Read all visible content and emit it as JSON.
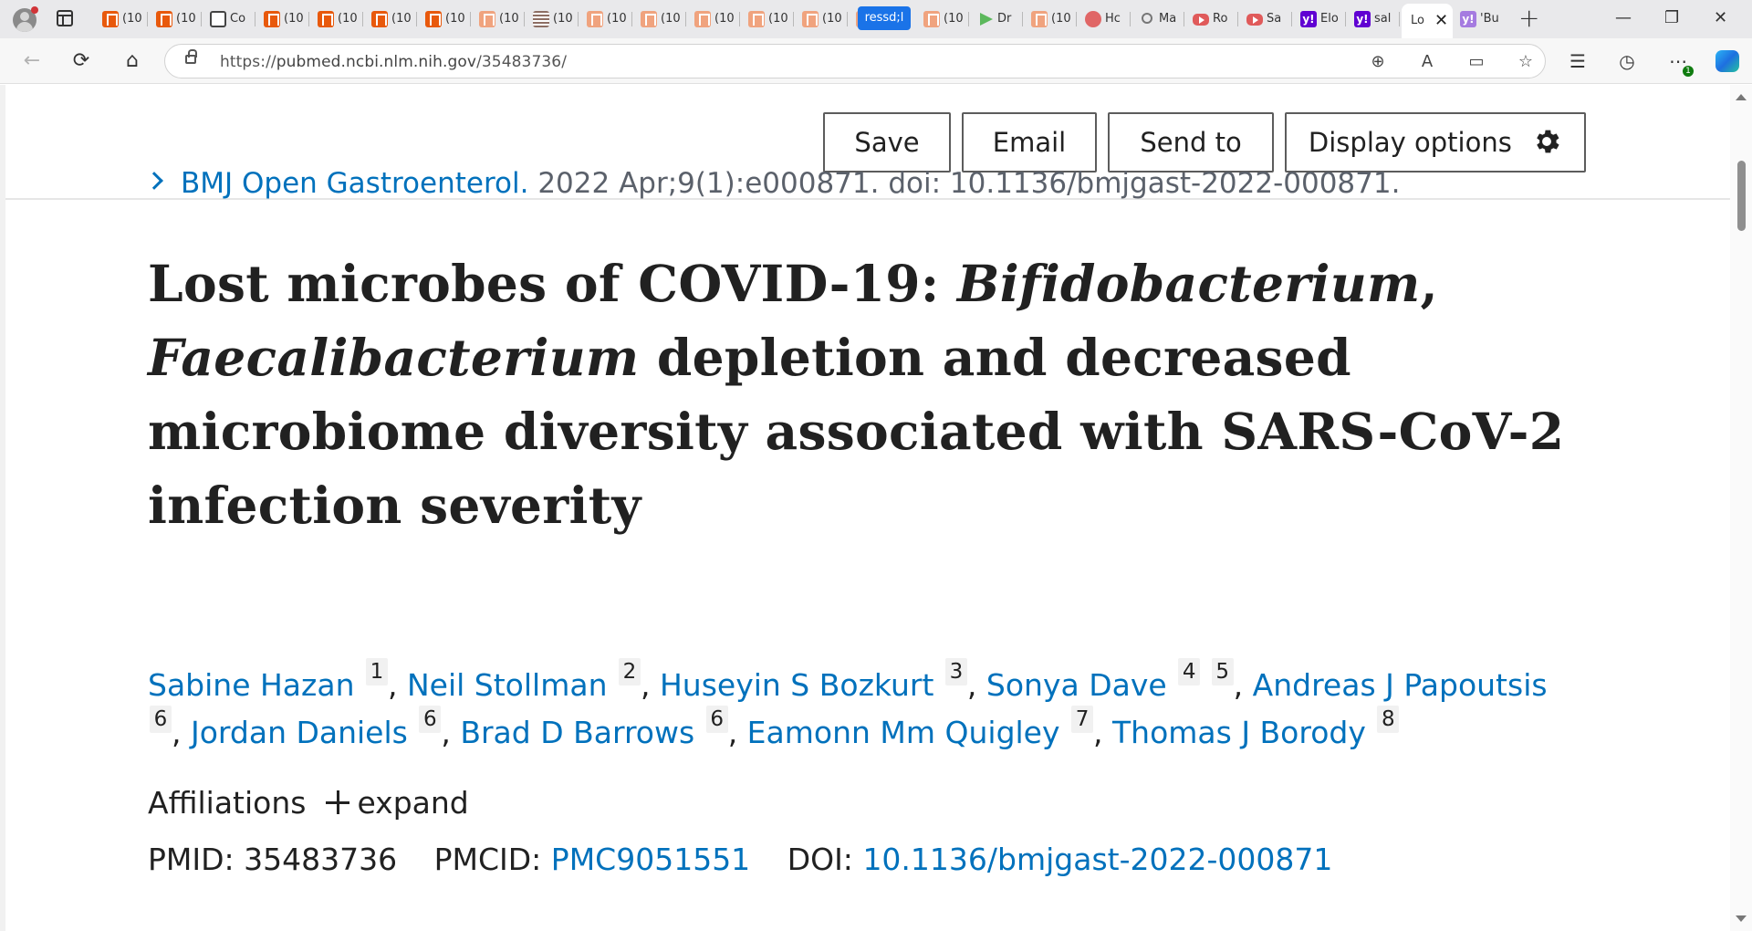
{
  "browser": {
    "tabs": [
      {
        "icon": "bookmark-icon",
        "label": "(10"
      },
      {
        "icon": "bookmark-icon",
        "label": "(10"
      },
      {
        "icon": "lock-icon",
        "label": "Co"
      },
      {
        "icon": "bookmark-icon",
        "label": "(10"
      },
      {
        "icon": "bookmark-icon",
        "label": "(10"
      },
      {
        "icon": "bookmark-icon",
        "label": "(10"
      },
      {
        "icon": "bookmark-icon",
        "label": "(10"
      },
      {
        "icon": "bookmark-light-icon",
        "label": "(10"
      },
      {
        "icon": "grid-icon",
        "label": "(10"
      },
      {
        "icon": "bookmark-light-icon",
        "label": "(10"
      },
      {
        "icon": "bookmark-light-icon",
        "label": "(10"
      },
      {
        "icon": "bookmark-light-icon",
        "label": "(10"
      },
      {
        "icon": "bookmark-light-icon",
        "label": "(10"
      },
      {
        "icon": "bookmark-light-icon",
        "label": "(10"
      },
      {
        "icon": "bookmark-light-icon",
        "label": "(10"
      }
    ],
    "highlight_tab": "ressd;l",
    "tabs_right": [
      {
        "icon": "bookmark-light-icon",
        "label": "(10"
      },
      {
        "icon": "play-icon",
        "label": "Dr"
      },
      {
        "icon": "bookmark-light-icon",
        "label": "(10"
      },
      {
        "icon": "pin-icon",
        "label": "Hc"
      },
      {
        "icon": "search-icon",
        "label": "Ma"
      },
      {
        "icon": "youtube-icon",
        "label": "Ro"
      },
      {
        "icon": "youtube-icon",
        "label": "Sa"
      },
      {
        "icon": "yahoo-icon",
        "label": "Elo"
      },
      {
        "icon": "yahoo-icon",
        "label": "sal"
      }
    ],
    "active_tab": {
      "label": "Lo",
      "close": "✕"
    },
    "last_tab": {
      "icon": "yahoo-light-icon",
      "label": "'Bu"
    },
    "new_tab": "+",
    "window": {
      "minimize": "—",
      "restore": "❐",
      "close": "✕"
    },
    "url": {
      "prefix": "https://",
      "host": "pubmed.ncbi.nlm.nih.gov",
      "path": "/35483736/"
    },
    "accent_colors": {
      "tab_strip": "#e9e9eb",
      "highlight_tab": "#1a73e8"
    }
  },
  "toolbar": {
    "save": "Save",
    "email": "Email",
    "send_to": "Send to",
    "display_options": "Display options"
  },
  "citation": {
    "journal": "BMJ Open Gastroenterol.",
    "details": " 2022 Apr;9(1):e000871. doi: 10.1136/bmjgast-2022-000871."
  },
  "article": {
    "title_part1": "Lost microbes of COVID-19: ",
    "title_italic1": "Bifidobacterium",
    "title_part2": ",",
    "title_italic2": "Faecalibacterium",
    "title_part3": " depletion and decreased microbiome diversity associated with SARS-CoV-2 infection severity",
    "authors": [
      {
        "name": "Sabine Hazan",
        "affs": [
          "1"
        ]
      },
      {
        "name": "Neil Stollman",
        "affs": [
          "2"
        ]
      },
      {
        "name": "Huseyin S Bozkurt",
        "affs": [
          "3"
        ]
      },
      {
        "name": "Sonya Dave",
        "affs": [
          "4",
          "5"
        ]
      },
      {
        "name": "Andreas J Papoutsis",
        "affs": [
          "6"
        ]
      },
      {
        "name": "Jordan Daniels",
        "affs": [
          "6"
        ]
      },
      {
        "name": "Brad D Barrows",
        "affs": [
          "6"
        ]
      },
      {
        "name": "Eamonn Mm Quigley",
        "affs": [
          "7"
        ]
      },
      {
        "name": "Thomas J Borody",
        "affs": [
          "8"
        ]
      }
    ],
    "affiliations_label": "Affiliations",
    "expand_label": "expand",
    "pmid_label": "PMID:",
    "pmid": "35483736",
    "pmcid_label": "PMCID:",
    "pmcid": "PMC9051551",
    "doi_label": "DOI:",
    "doi": "10.1136/bmjgast-2022-000871"
  },
  "colors": {
    "link": "#0071bc",
    "text": "#212121",
    "muted": "#5b616b",
    "badge_bg": "#f1f1f1"
  }
}
